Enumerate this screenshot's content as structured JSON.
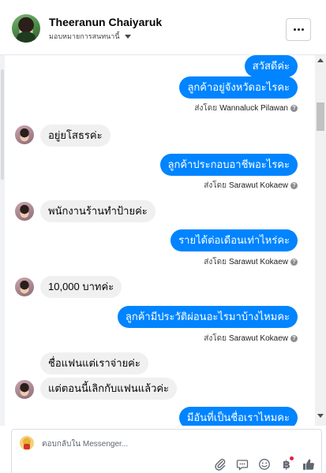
{
  "header": {
    "user_name": "Theeranun Chaiyaruk",
    "assign_label": "มอบหมายการสนทนานี้"
  },
  "messages": [
    {
      "id": "m1",
      "direction": "outgoing",
      "text": "สวัสดีค่ะ"
    },
    {
      "id": "m2",
      "direction": "outgoing",
      "text": "ลูกค้าอยู่จังหวัดอะไรคะ"
    },
    {
      "id": "s1",
      "type": "sent_by",
      "prefix": "ส่งโดย",
      "agent": "Wannaluck Pilawan"
    },
    {
      "id": "m3",
      "direction": "incoming",
      "text": "อยู่ยโสธรค่ะ"
    },
    {
      "id": "m4",
      "direction": "outgoing",
      "text": "ลูกค้าประกอบอาชีพอะไรคะ"
    },
    {
      "id": "s2",
      "type": "sent_by",
      "prefix": "ส่งโดย",
      "agent": "Sarawut Kokaew"
    },
    {
      "id": "m5",
      "direction": "incoming",
      "text": "พนักงานร้านทำป้ายค่ะ"
    },
    {
      "id": "m6",
      "direction": "outgoing",
      "text": "รายได้ต่อเดือนเท่าไหร่คะ"
    },
    {
      "id": "s3",
      "type": "sent_by",
      "prefix": "ส่งโดย",
      "agent": "Sarawut Kokaew"
    },
    {
      "id": "m7",
      "direction": "incoming",
      "text": "10,000 บาทค่ะ"
    },
    {
      "id": "m8",
      "direction": "outgoing",
      "text": "ลูกค้ามีประวัติผ่อนอะไรมาบ้างไหมคะ"
    },
    {
      "id": "s4",
      "type": "sent_by",
      "prefix": "ส่งโดย",
      "agent": "Sarawut Kokaew"
    },
    {
      "id": "m9",
      "direction": "incoming",
      "text": "ชื่อแฟนแต่เราจ่ายค่ะ"
    },
    {
      "id": "m10",
      "direction": "incoming",
      "text": "แต่ตอนนี้เลิกกับแฟนแล้วค่ะ"
    },
    {
      "id": "m11",
      "direction": "outgoing",
      "text": "มีอันที่เป็นชื่อเราไหมคะ"
    }
  ],
  "composer": {
    "placeholder": "ตอบกลับใน Messenger...",
    "baht_symbol": "฿"
  },
  "icons": {
    "more": "more-horizontal-icon",
    "attach": "paperclip-icon",
    "saved_replies": "saved-replies-icon",
    "emoji": "emoji-icon",
    "payment": "baht-icon",
    "like": "thumbs-up-icon",
    "help": "question-icon"
  },
  "colors": {
    "outgoing_bubble": "#0084ff",
    "incoming_bubble": "#f0f0f0",
    "like_icon": "#0084ff",
    "notification_dot": "#e41e3f"
  }
}
